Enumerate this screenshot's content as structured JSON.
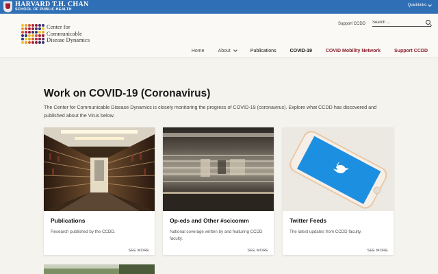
{
  "topbar": {
    "name": "HARVARD T.H. CHAN",
    "sub": "SCHOOL OF PUBLIC HEALTH",
    "quicklinks": "Quicklinks"
  },
  "logo": {
    "line1": "Center for",
    "line2": "Communicable",
    "line3": "Disease Dynamics",
    "dot_colors": [
      "#f2c12e",
      "#e0a62a",
      "#d4553a",
      "#b3213b",
      "#8e1f3f",
      "#4b2b61",
      "#2b3b7a"
    ]
  },
  "utility": {
    "support_link": "Support CCDD",
    "search_placeholder": "Search ..."
  },
  "nav": {
    "home": "Home",
    "about": "About",
    "publications": "Publications",
    "covid": "COVID-19",
    "mobility": "COVID Mobility Network",
    "support": "Support CCDD"
  },
  "main": {
    "title": "Work on COVID-19 (Coronavirus)",
    "intro": "The Center for Communicable Disease Dynamics is closely monitoring the progress of COVID-19 (coronavirus). Explore what CCDD has discovered and published about the Virus below."
  },
  "cards": [
    {
      "title": "Publications",
      "desc": "Research published by the CCDD.",
      "more": "SEE MORE"
    },
    {
      "title": "Op-eds and Other #scicomm",
      "desc": "National coverage written by and featuring CCDD faculty.",
      "more": "SEE MORE"
    },
    {
      "title": "Twitter Feeds",
      "desc": "The latest updates from CCDD faculty.",
      "more": "SEE MORE"
    }
  ],
  "colors": {
    "harvard_blue": "#2f6fb5",
    "crimson": "#8a1c2b",
    "background": "#f5f3ee"
  }
}
